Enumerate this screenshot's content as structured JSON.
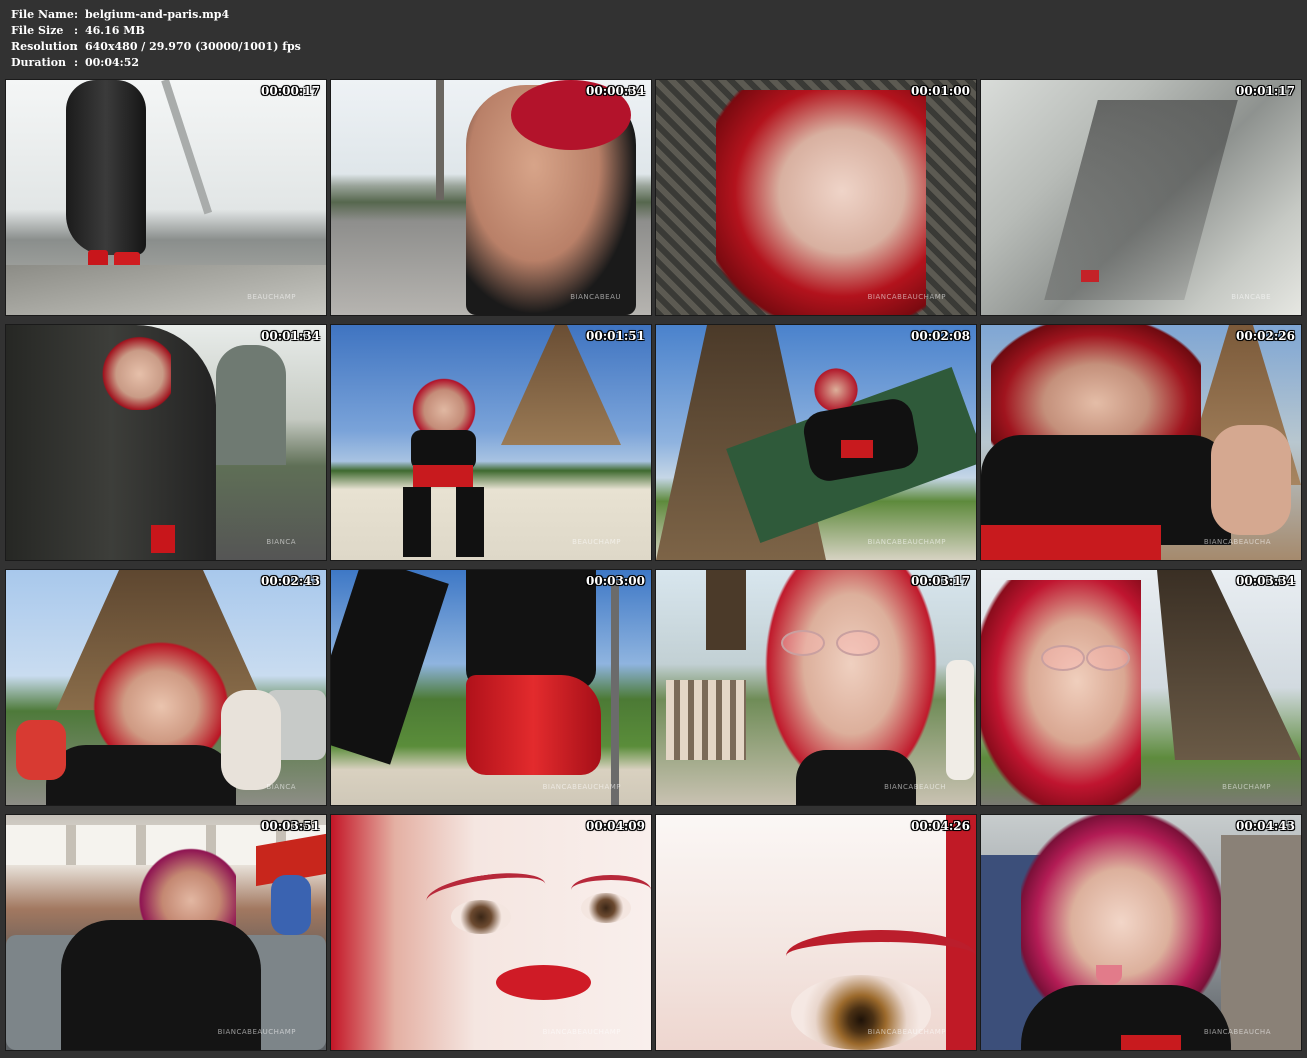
{
  "header": {
    "rows": [
      {
        "key": "File Name",
        "sep": ":",
        "value": "belgium-and-paris.mp4"
      },
      {
        "key": "File Size",
        "sep": ":",
        "value": "46.16 MB"
      },
      {
        "key": "Resolution",
        "sep": ":",
        "value": "640x480 / 29.970 (30000/1001) fps"
      },
      {
        "key": "Duration",
        "sep": ":",
        "value": "00:04:52"
      }
    ]
  },
  "thumbnails": [
    {
      "timestamp": "00:00:17",
      "watermark": "BEAUCHAMP"
    },
    {
      "timestamp": "00:00:34",
      "watermark": "BIANCABEAU"
    },
    {
      "timestamp": "00:01:00",
      "watermark": "BIANCABEAUCHAMP"
    },
    {
      "timestamp": "00:01:17",
      "watermark": "BIANCABE"
    },
    {
      "timestamp": "00:01:34",
      "watermark": "BIANCA"
    },
    {
      "timestamp": "00:01:51",
      "watermark": "BEAUCHAMP"
    },
    {
      "timestamp": "00:02:08",
      "watermark": "BIANCABEAUCHAMP"
    },
    {
      "timestamp": "00:02:26",
      "watermark": "BIANCABEAUCHA"
    },
    {
      "timestamp": "00:02:43",
      "watermark": "BIANCA"
    },
    {
      "timestamp": "00:03:00",
      "watermark": "BIANCABEAUCHAMP"
    },
    {
      "timestamp": "00:03:17",
      "watermark": "BIANCABEAUCH"
    },
    {
      "timestamp": "00:03:34",
      "watermark": "BEAUCHAMP"
    },
    {
      "timestamp": "00:03:51",
      "watermark": "BIANCABEAUCHAMP"
    },
    {
      "timestamp": "00:04:09",
      "watermark": "BIANCABEAUCHAMP"
    },
    {
      "timestamp": "00:04:26",
      "watermark": "BIANCABEAUCHAMP"
    },
    {
      "timestamp": "00:04:43",
      "watermark": "BIANCABEAUCHA"
    }
  ]
}
